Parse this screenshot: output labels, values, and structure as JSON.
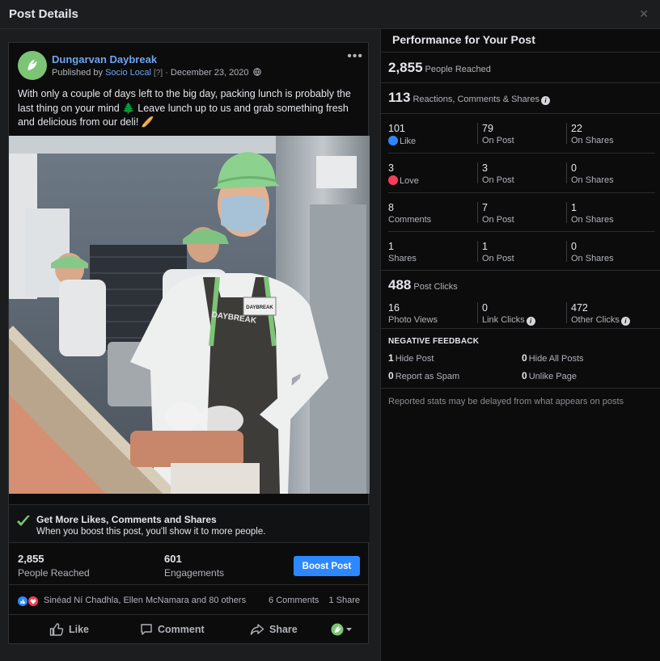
{
  "window": {
    "title": "Post Details",
    "close_glyph": "✕"
  },
  "post": {
    "page_name": "Dungarvan Daybreak",
    "published_by_prefix": "Published by",
    "publisher": "Socio Local",
    "help_marker": "[?]",
    "separator": "·",
    "date": "December 23, 2020",
    "more_glyph": "•••",
    "text": "With only a couple of days left to the big day, packing lunch is probably the last thing on your mind 🌲 Leave lunch up to us and grab something fresh and delicious from our deli! 🥖",
    "apron_text": "DAYBREAK",
    "badge_text": "DAYBREAK"
  },
  "boost": {
    "title": "Get More Likes, Comments and Shares",
    "subtitle": "When you boost this post, you'll show it to more people.",
    "reached_num": "2,855",
    "reached_label": "People Reached",
    "engagements_num": "601",
    "engagements_label": "Engagements",
    "button_label": "Boost Post"
  },
  "reactions": {
    "names": "Sinéad Ní Chadhla, Ellen McNamara and 80 others",
    "comments": "6 Comments",
    "shares": "1 Share"
  },
  "actions": {
    "like": "Like",
    "comment": "Comment",
    "share": "Share"
  },
  "performance": {
    "title": "Performance for Your Post",
    "reached_num": "2,855",
    "reached_label": "People Reached",
    "rcs_num": "113",
    "rcs_label": "Reactions, Comments & Shares",
    "rows": [
      {
        "total": "101",
        "total_label": "Like",
        "on_post": "79",
        "on_post_label": "On Post",
        "on_shares": "22",
        "on_shares_label": "On Shares"
      },
      {
        "total": "3",
        "total_label": "Love",
        "on_post": "3",
        "on_post_label": "On Post",
        "on_shares": "0",
        "on_shares_label": "On Shares"
      },
      {
        "total": "8",
        "total_label": "Comments",
        "on_post": "7",
        "on_post_label": "On Post",
        "on_shares": "1",
        "on_shares_label": "On Shares"
      },
      {
        "total": "1",
        "total_label": "Shares",
        "on_post": "1",
        "on_post_label": "On Post",
        "on_shares": "0",
        "on_shares_label": "On Shares"
      }
    ],
    "clicks_num": "488",
    "clicks_label": "Post Clicks",
    "photo_views": "16",
    "photo_views_label": "Photo Views",
    "link_clicks": "0",
    "link_clicks_label": "Link Clicks",
    "other_clicks": "472",
    "other_clicks_label": "Other Clicks",
    "info_glyph": "i",
    "negative_title": "NEGATIVE FEEDBACK",
    "hide_post": "1",
    "hide_post_label": "Hide Post",
    "hide_all": "0",
    "hide_all_label": "Hide All Posts",
    "spam": "0",
    "spam_label": "Report as Spam",
    "unlike": "0",
    "unlike_label": "Unlike Page",
    "footnote": "Reported stats may be delayed from what appears on posts"
  },
  "colors": {
    "accent": "#2d88ff",
    "brand_green": "#7cc576",
    "link": "#6ea4f0"
  }
}
